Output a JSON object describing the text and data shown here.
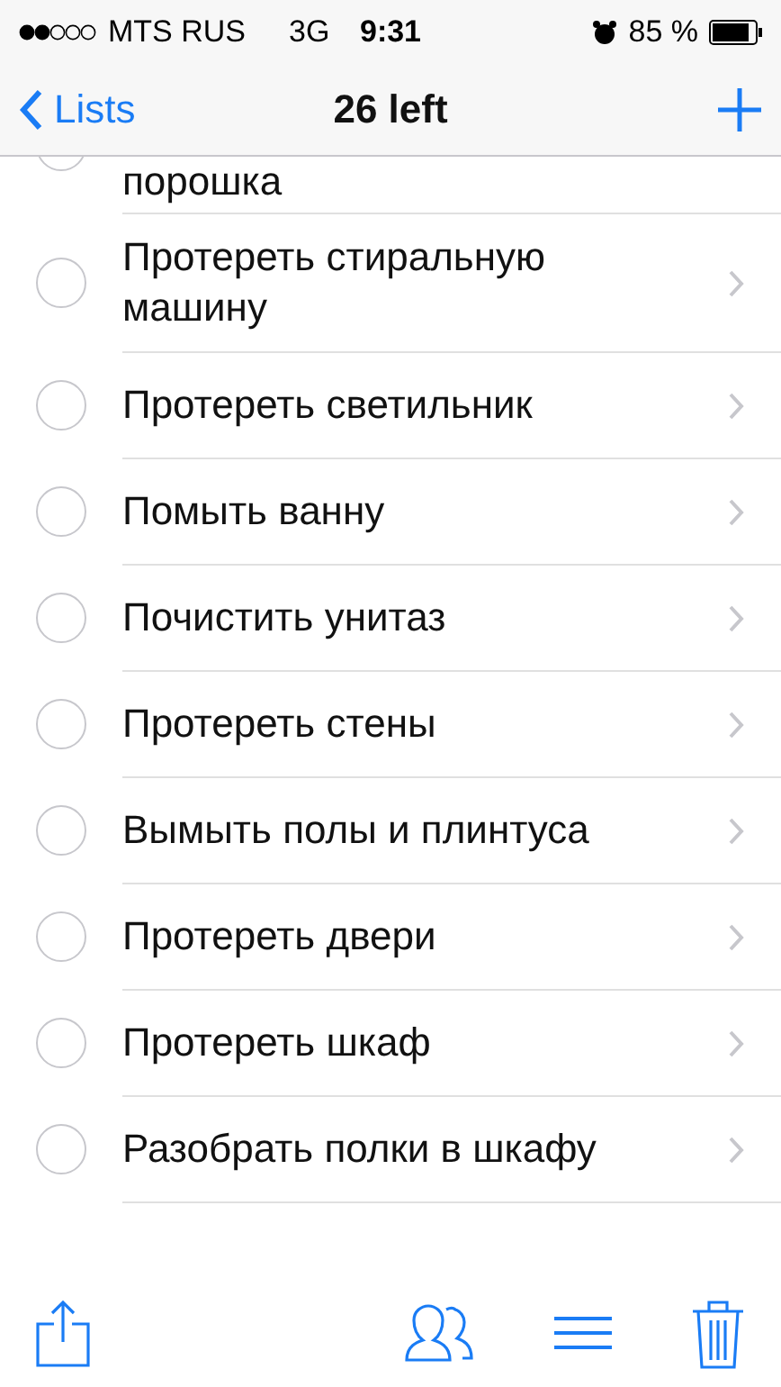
{
  "status_bar": {
    "carrier": "MTS RUS",
    "network": "3G",
    "time": "9:31",
    "battery": "85 %"
  },
  "nav": {
    "back": "Lists",
    "title": "26 left"
  },
  "items": [
    {
      "text": "порошка",
      "checked": false,
      "kind": "partial"
    },
    {
      "text": "Протереть стиральную машину",
      "checked": false,
      "kind": "full"
    },
    {
      "text": "Протереть светильник",
      "checked": false,
      "kind": "full"
    },
    {
      "text": "Помыть ванну",
      "checked": false,
      "kind": "full"
    },
    {
      "text": "Почистить унитаз",
      "checked": false,
      "kind": "full"
    },
    {
      "text": "Протереть стены",
      "checked": false,
      "kind": "full"
    },
    {
      "text": "Вымыть полы и плинтуса",
      "checked": false,
      "kind": "full"
    },
    {
      "text": "Протереть двери",
      "checked": false,
      "kind": "full"
    },
    {
      "text": "Протереть шкаф",
      "checked": false,
      "kind": "full"
    },
    {
      "text": "Разобрать полки в шкафу",
      "checked": false,
      "kind": "full"
    }
  ]
}
